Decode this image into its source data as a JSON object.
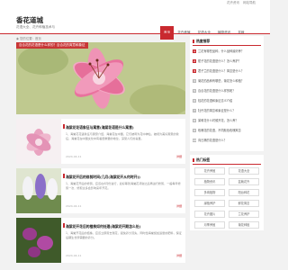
{
  "top_links": [
    "花卉资讯",
    "网站导航"
  ],
  "site": {
    "name": "香花道城",
    "slogan": "花语大全、花卉种植技术与"
  },
  "nav": [
    "首页",
    "花卉养殖",
    "花语大全",
    "植物资讯",
    "盆栽"
  ],
  "breadcrumb": "◉ 您的位置：首页",
  "hero": {
    "caption": "百合花的花语是什么样的？百合花的寓意和象征"
  },
  "articles": [
    {
      "title": "海棠花花语象征与寓意(海棠花语是什么寓意)",
      "desc": "1、海棠花花语象征与寓意介绍，海棠花在中国，它们被称为花中神仙，被视为美好寓意的象征，海棠花在中国文化中有着很重要的地位，深受人们的喜爱。",
      "date": "2024-04-11",
      "more": "详细"
    },
    {
      "title": "海棠花开后的修剪时间(几月(海棠花开从何时开))",
      "desc": "1、海棠花开后的修剪，应该在4月份进行，最好等到海棠花凋谢之后再进行修剪，一般每年修剪一次，修剪过多会影响来年开花。",
      "date": "2024-04-11",
      "more": "详细"
    },
    {
      "title": "海棠花开花后的植株如何处理(海棠花开期怎么处)",
      "desc": "1、海棠开花后的植株，应该立即剪去残花，避免养分流失，同时给海棠施加适量的肥料，保证后期生长所需要的养分。",
      "date": "2024-04-11",
      "more": "详细"
    }
  ],
  "hot_panel": {
    "title": "热度推荐",
    "items": [
      "兰花有哪些品种，什么品种最好养？",
      "栀子花的花语是什么？怎么养护？",
      "君子兰的花语是什么？寓意是什么？",
      "菊花的品种有哪些，菊花怎么种植？",
      "百合花的花语是什么样的呢？",
      "桂花的花语和象征意义介绍",
      "牡丹花的寓意和象征是什么？",
      "茉莉花什么时候开花，怎么养？",
      "玫瑰花的花语，不同颜色玫瑰寓意",
      "向日葵的花语是什么？"
    ]
  },
  "tags_panel": {
    "title": "热门标签",
    "items": [
      "花卉养殖",
      "花语大全",
      "植物资讯",
      "盆栽花卉",
      "多肉植物",
      "阳台种花",
      "绿植养护",
      "鲜花寓意",
      "花卉图片",
      "兰花养护",
      "月季养殖",
      "菊花种植"
    ]
  }
}
